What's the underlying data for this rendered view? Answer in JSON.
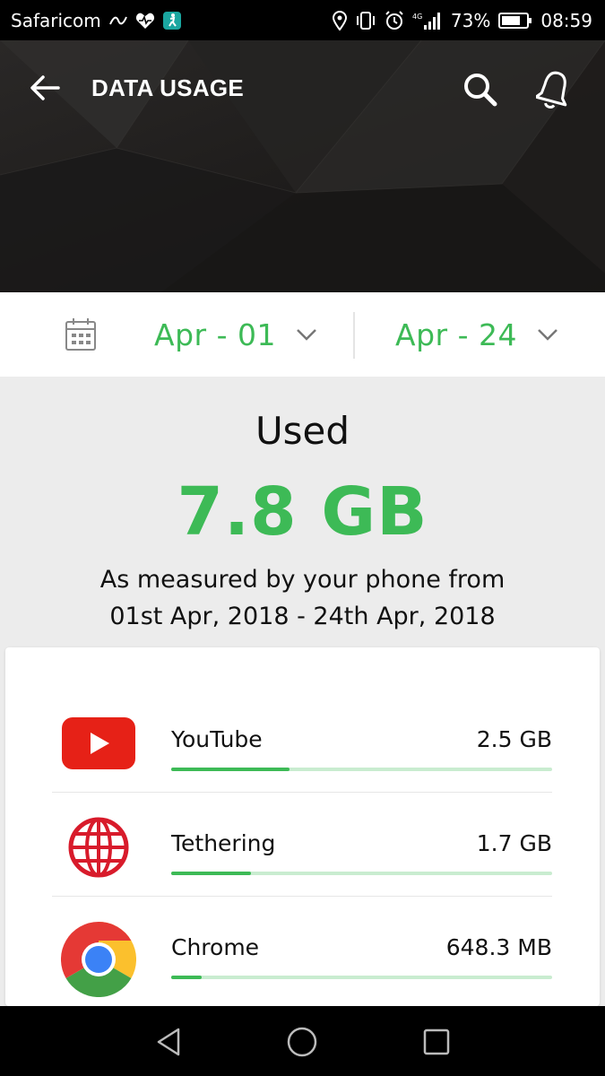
{
  "status_bar": {
    "carrier": "Safaricom",
    "network": "4G",
    "battery": "73%",
    "time": "08:59"
  },
  "header": {
    "title": "DATA USAGE"
  },
  "date_range": {
    "from": "Apr - 01",
    "to": "Apr - 24"
  },
  "summary": {
    "used_label": "Used",
    "used_value": "7.8 GB",
    "measured_line1": "As measured by your phone from",
    "measured_line2": "01st Apr, 2018 - 24th Apr, 2018"
  },
  "apps": [
    {
      "name": "YouTube",
      "size": "2.5 GB",
      "usage_fraction": 0.31,
      "icon": "youtube-icon"
    },
    {
      "name": "Tethering",
      "size": "1.7 GB",
      "usage_fraction": 0.21,
      "icon": "globe-icon"
    },
    {
      "name": "Chrome",
      "size": "648.3 MB",
      "usage_fraction": 0.08,
      "icon": "chrome-icon"
    }
  ],
  "colors": {
    "accent_green": "#3dba56",
    "track_green": "#c9ecd0",
    "youtube_red": "#e62117",
    "tethering_red": "#d81b2b"
  }
}
